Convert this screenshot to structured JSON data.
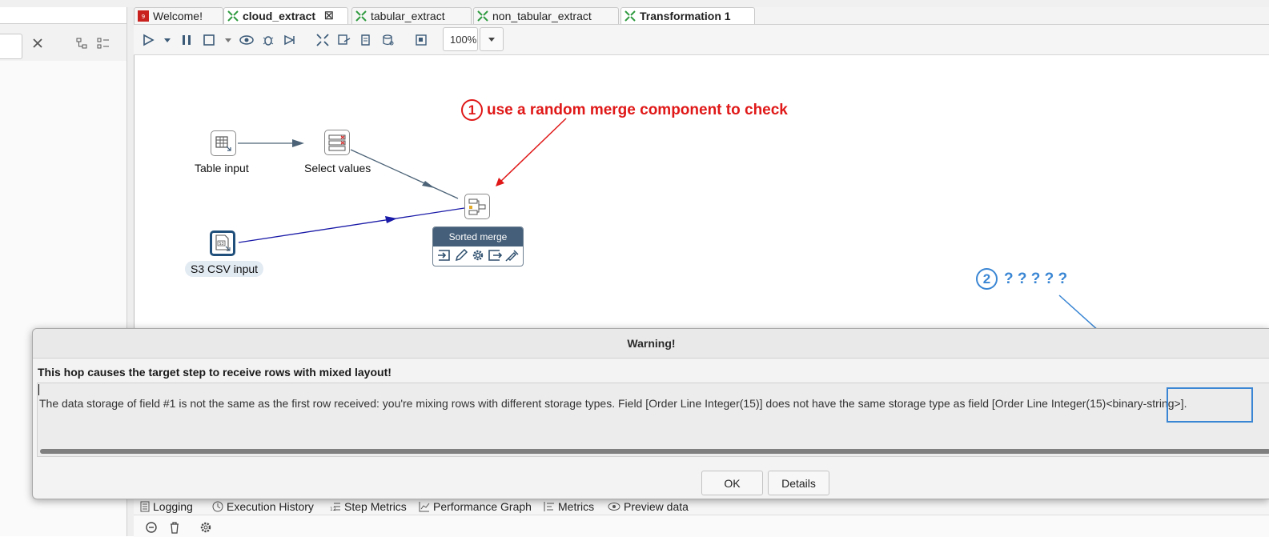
{
  "tabs": [
    {
      "label": "Welcome!",
      "icon": "welcome-icon"
    },
    {
      "label": "cloud_extract",
      "icon": "transformation-icon"
    },
    {
      "label": "tabular_extract",
      "icon": "transformation-icon"
    },
    {
      "label": "non_tabular_extract",
      "icon": "transformation-icon"
    },
    {
      "label": "Transformation 1",
      "icon": "transformation-icon"
    }
  ],
  "toolbar": {
    "zoom": "100%"
  },
  "steps": {
    "table_input": "Table input",
    "select_values": "Select values",
    "s3_csv_input": "S3 CSV input",
    "sorted_merge": "Sorted merge",
    "s3_badge": "S3"
  },
  "annotations": {
    "note1_number": "1",
    "note1_text": "use a random merge component to check",
    "note2_number": "2",
    "note2_text": "? ? ? ? ?"
  },
  "dialog": {
    "title": "Warning!",
    "heading": "This hop causes the target step to receive rows with mixed layout!",
    "message": "The data storage of field #1 is not the same as the first row received: you're mixing rows with different storage types. Field [Order Line Integer(15)] does not have the same storage type as field [Order Line Integer(15)<binary-string>].",
    "ok_label": "OK",
    "details_label": "Details"
  },
  "bottom_tabs": [
    "Logging",
    "Execution History",
    "Step Metrics",
    "Performance Graph",
    "Metrics",
    "Preview data"
  ],
  "colors": {
    "annotation_red": "#e01818",
    "annotation_blue": "#3a86d4",
    "hop_blue": "#1a1aa8",
    "hop_gray": "#4d6478",
    "tab_green": "#2e9a3f"
  }
}
